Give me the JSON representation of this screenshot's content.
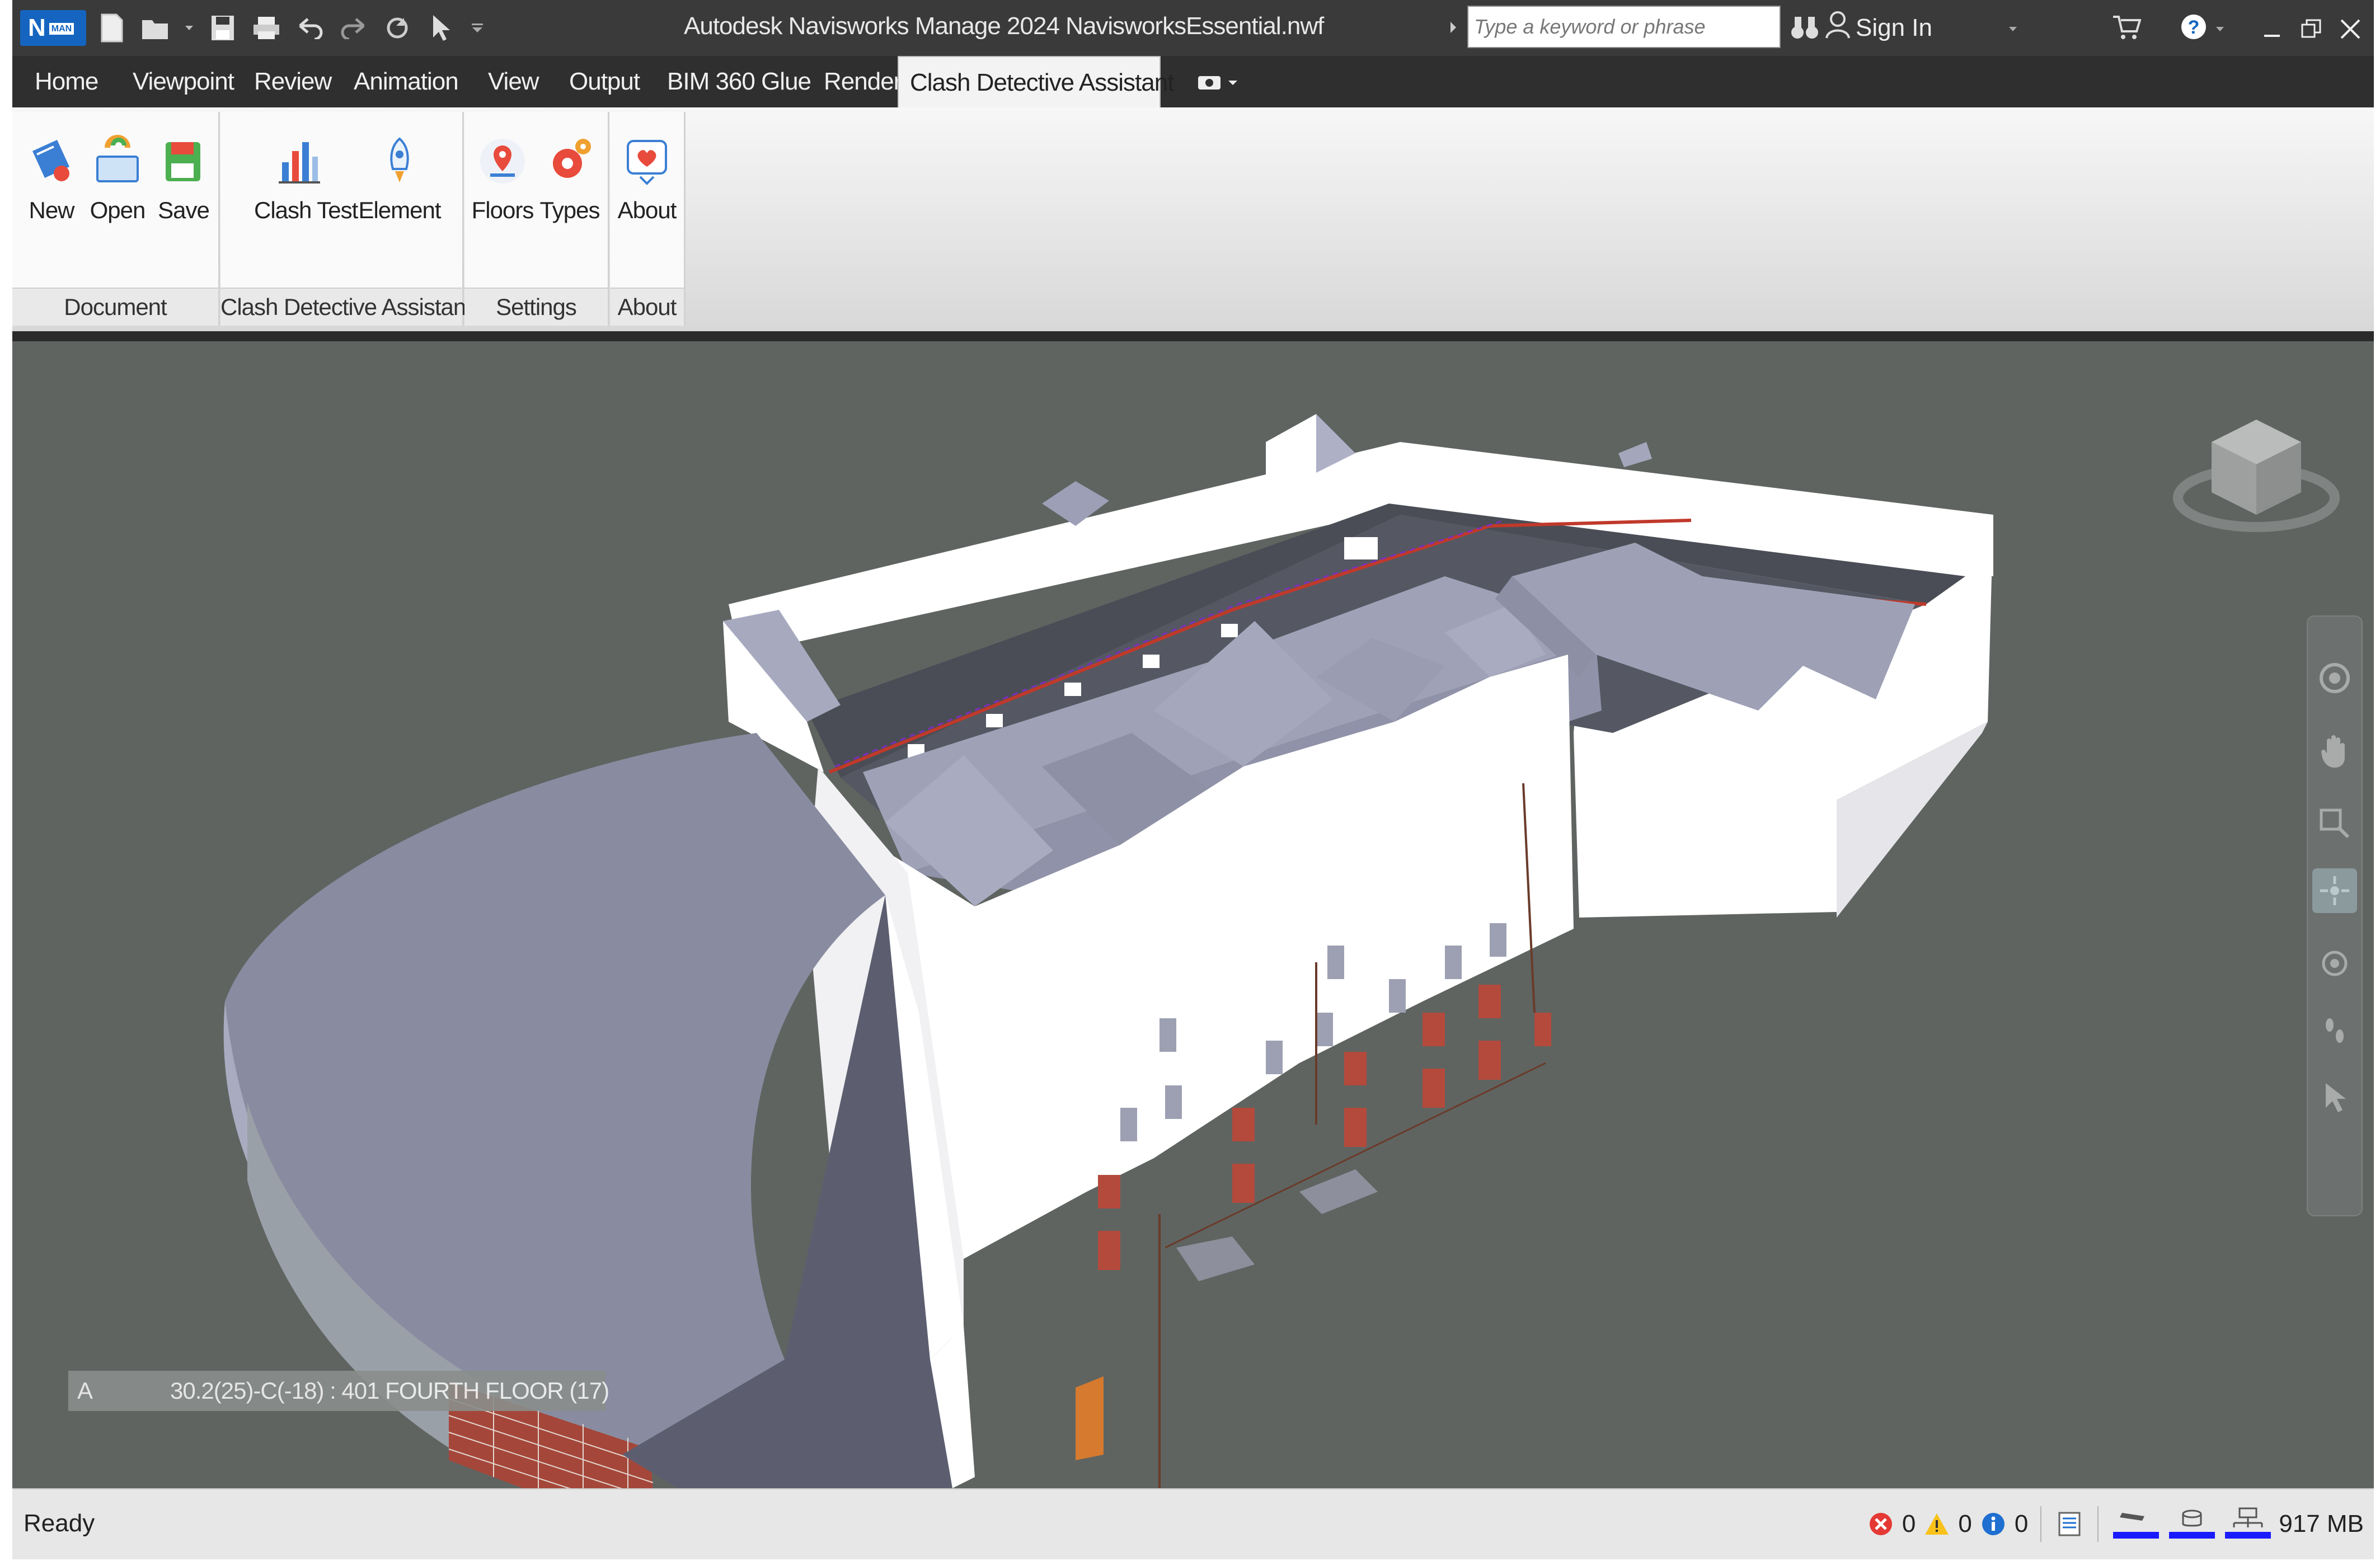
{
  "title_bar": {
    "app_badge": "N",
    "app_badge_sub": "MAN",
    "title": "Autodesk Navisworks Manage 2024    NavisworksEssential.nwf",
    "search_placeholder": "Type a keyword or phrase",
    "sign_in": "Sign In"
  },
  "tabs": [
    {
      "label": "Home"
    },
    {
      "label": "Viewpoint"
    },
    {
      "label": "Review"
    },
    {
      "label": "Animation"
    },
    {
      "label": "View"
    },
    {
      "label": "Output"
    },
    {
      "label": "BIM 360 Glue"
    },
    {
      "label": "Render"
    },
    {
      "label": "Clash Detective Assistant"
    }
  ],
  "ribbon": {
    "document": {
      "title": "Document",
      "new": "New",
      "open": "Open",
      "save": "Save"
    },
    "clash": {
      "title": "Clash Detective Assistant",
      "clash_test": "Clash Test",
      "element": "Element"
    },
    "settings": {
      "title": "Settings",
      "floors": "Floors",
      "types": "Types"
    },
    "about": {
      "title": "About",
      "about": "About"
    }
  },
  "viewport": {
    "grid_label": "A",
    "grid_location": "30.2(25)-C(-18) : 401 FOURTH FLOOR (17)",
    "background": "#5f6461"
  },
  "status": {
    "ready": "Ready",
    "errors": "0",
    "warnings": "0",
    "info": "0",
    "memory": "917 MB"
  },
  "colors": {
    "active_tab": "#f3f3f3",
    "app_blue": "#1565c0",
    "roof": "#8e8fa3",
    "wall": "#ffffff",
    "brick": "#a8473a"
  }
}
